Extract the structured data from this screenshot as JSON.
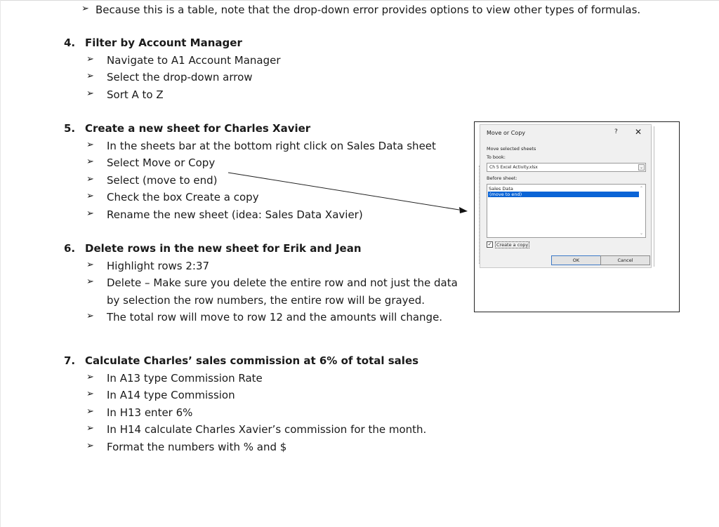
{
  "intro_note": "Because this is a table, note that the drop-down error provides options to view other types of formulas.",
  "sections": [
    {
      "number": "4.",
      "heading": "Filter by Account Manager",
      "bullets": [
        "Navigate to A1 Account Manager",
        "Select the drop-down arrow",
        "Sort A to Z"
      ]
    },
    {
      "number": "5.",
      "heading": "Create a new sheet for Charles Xavier",
      "bullets": [
        "In the sheets bar at the bottom right click on Sales Data sheet",
        "Select Move or Copy",
        "Select (move to end)",
        "Check the box Create a copy",
        "Rename the new sheet (idea: Sales Data Xavier)"
      ]
    },
    {
      "number": "6.",
      "heading": "Delete rows in the new sheet for Erik and Jean",
      "bullets": [
        "Highlight rows 2:37",
        "Delete – Make sure you delete the entire row and not just the data",
        "by selection the row numbers, the entire row will be grayed.",
        "The total row will move to row 12 and the amounts will change."
      ]
    },
    {
      "number": "7.",
      "heading": "Calculate Charles’ sales commission at 6% of total sales",
      "bullets": [
        "In A13 type Commission Rate",
        "In A14 type Commission",
        "In H13 enter 6%",
        "In H14 calculate Charles Xavier’s commission for the month.",
        "Format the numbers with % and $"
      ]
    }
  ],
  "bullet_glyph": "➢",
  "dialog": {
    "title": "Move or Copy",
    "help": "?",
    "close": "✕",
    "move_selected_label": "Move selected sheets",
    "to_book_label": "To book:",
    "to_book_value": "Ch 5  Excel Activity.xlsx",
    "before_sheet_label": "Before sheet:",
    "sheets": [
      "Sales Data",
      "(move to end)"
    ],
    "selected_sheet": "(move to end)",
    "create_copy_label": "Create a copy",
    "create_copy_checked": true,
    "ok_label": "OK",
    "cancel_label": "Cancel"
  },
  "colors": {
    "selection": "#0a64d6",
    "dialog_bg": "#f0f0f0"
  }
}
